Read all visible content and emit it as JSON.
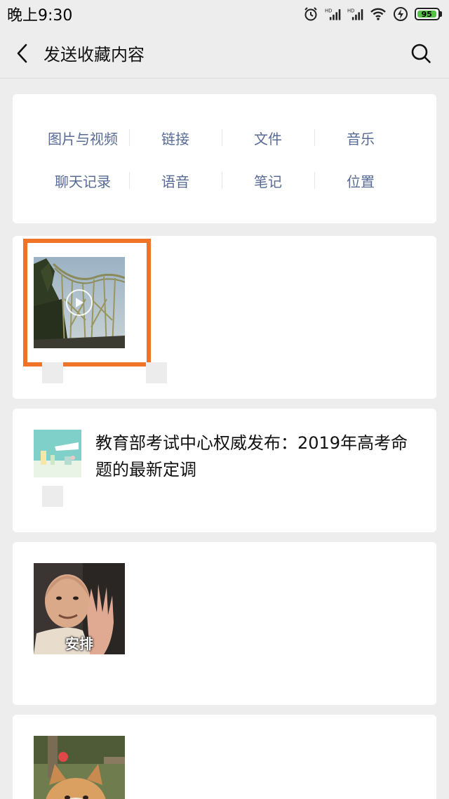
{
  "status": {
    "time": "晚上9:30",
    "battery": "95",
    "icons": [
      "alarm-icon",
      "hd-signal-icon",
      "hd-signal-icon",
      "wifi-icon",
      "charging-icon",
      "battery-icon"
    ]
  },
  "header": {
    "title": "发送收藏内容",
    "back_icon": "chevron-left-icon",
    "search_icon": "search-icon"
  },
  "categories": {
    "row1": [
      "图片与视频",
      "链接",
      "文件",
      "音乐"
    ],
    "row2": [
      "聊天记录",
      "语音",
      "笔记",
      "位置"
    ]
  },
  "items": [
    {
      "type": "video",
      "thumbnail": "roller-coaster-photo"
    },
    {
      "type": "link",
      "title": "教育部考试中心权威发布：2019年高考命题的最新定调"
    },
    {
      "type": "sticker",
      "caption": "安排"
    },
    {
      "type": "image",
      "thumbnail": "shiba-dog-photo"
    }
  ],
  "colors": {
    "link": "#576b95",
    "highlight": "#f07328",
    "background": "#ededed",
    "battery": "#56c243"
  }
}
